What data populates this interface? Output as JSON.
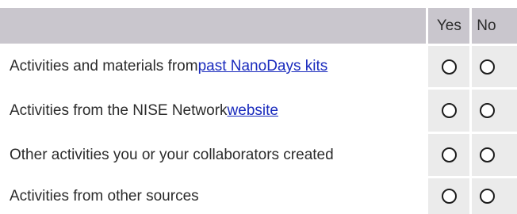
{
  "table": {
    "header": {
      "question_label": "",
      "yes_label": "Yes",
      "no_label": "No"
    },
    "rows": [
      {
        "text_before": "Activities and materials from ",
        "link_text": "past NanoDays kits",
        "text_after": "",
        "yes_selected": false,
        "no_selected": false
      },
      {
        "text_before": "Activities from the NISE Network ",
        "link_text": "website",
        "text_after": "",
        "yes_selected": false,
        "no_selected": false
      },
      {
        "text_before": "Other activities you or your collaborators created",
        "link_text": "",
        "text_after": "",
        "yes_selected": false,
        "no_selected": false
      },
      {
        "text_before": "Activities from other sources",
        "link_text": "",
        "text_after": "",
        "yes_selected": false,
        "no_selected": false
      }
    ]
  }
}
